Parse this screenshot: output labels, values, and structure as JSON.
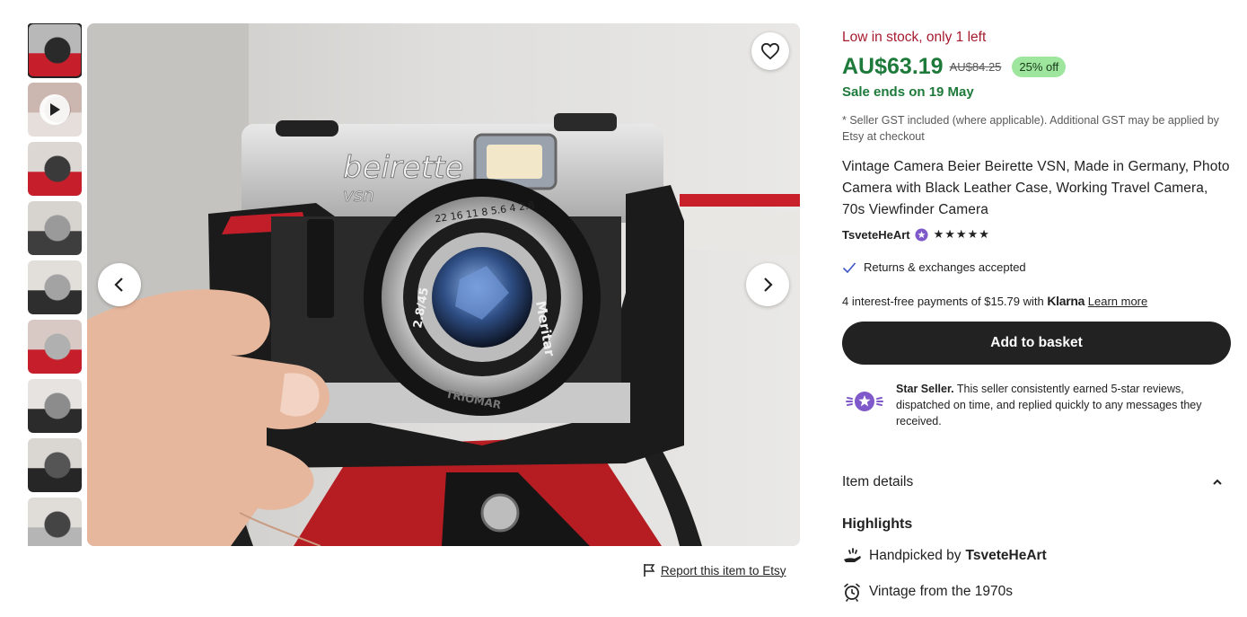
{
  "thumbnails": [
    {
      "name": "thumb-1",
      "colors": [
        "#b8b8b8",
        "#2a2a2a",
        "#c61e2b"
      ],
      "selected": true
    },
    {
      "name": "thumb-video",
      "colors": [
        "#cbb6b0",
        "#8e6f66",
        "#e5dedb"
      ],
      "video": true
    },
    {
      "name": "thumb-3",
      "colors": [
        "#dcd7d2",
        "#3a3a3a",
        "#c61e2b"
      ]
    },
    {
      "name": "thumb-4",
      "colors": [
        "#d7d3cf",
        "#9a9a9a",
        "#3e3e3e"
      ]
    },
    {
      "name": "thumb-5",
      "colors": [
        "#e2dfdb",
        "#a3a3a3",
        "#2e2e2e"
      ]
    },
    {
      "name": "thumb-6",
      "colors": [
        "#d9c9c4",
        "#b0b0b0",
        "#c61e2b"
      ]
    },
    {
      "name": "thumb-7",
      "colors": [
        "#e6e3e0",
        "#8c8c8c",
        "#2b2b2b"
      ]
    },
    {
      "name": "thumb-8",
      "colors": [
        "#dad6d2",
        "#555555",
        "#262626"
      ]
    },
    {
      "name": "thumb-9",
      "colors": [
        "#e0dcd8",
        "#444444",
        "#b5b5b5"
      ]
    }
  ],
  "main_image": {
    "brand_text": "beirette",
    "model_text": "vsn",
    "lens_text": "Meritar",
    "lens_aperture": "2.8/45",
    "lens_scale": "22 16 11 8 5.6 4 2.8",
    "lens_brand": "TRIOMAR"
  },
  "report_link": "Report this item to Etsy",
  "listing": {
    "stock_text": "Low in stock, only 1 left",
    "price": "AU$63.19",
    "old_price": "AU$84.25",
    "discount": "25% off",
    "sale_ends": "Sale ends on 19 May",
    "gst_note": "* Seller GST included (where applicable). Additional GST may be applied by Etsy at checkout",
    "title": "Vintage Camera Beier Beirette VSN, Made in Germany, Photo Camera with Black Leather Case, Working Travel Camera, 70s Viewfinder Camera",
    "seller": "TsveteHeArt",
    "stars": "★★★★★",
    "returns": "Returns & exchanges accepted",
    "klarna_prefix": "4 interest-free payments of $15.79 with ",
    "klarna_logo": "Klarna",
    "klarna_link": "Learn more",
    "add_to_basket": "Add to basket",
    "star_seller_bold": "Star Seller.",
    "star_seller_text": " This seller consistently earned 5-star reviews, dispatched on time, and replied quickly to any messages they received.",
    "item_details": "Item details",
    "highlights_title": "Highlights",
    "handpicked_prefix": "Handpicked by",
    "handpicked_seller": "TsveteHeArt",
    "vintage_text": "Vintage from the 1970s"
  },
  "colors": {
    "price_green": "#1d7a3a",
    "stock_red": "#a61a2e",
    "discount_bg": "#9ee59e",
    "button_dark": "#222222",
    "star_seller_purple": "#7f58c9"
  }
}
